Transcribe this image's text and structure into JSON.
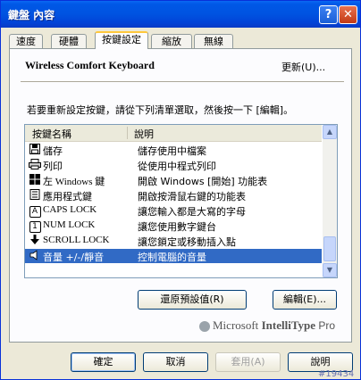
{
  "window": {
    "title": "鍵盤 內容",
    "help_glyph": "?",
    "close_glyph": "✕"
  },
  "tabs": [
    {
      "label": "速度"
    },
    {
      "label": "硬體"
    },
    {
      "label": "按鍵設定",
      "active": true
    },
    {
      "label": "縮放"
    },
    {
      "label": "無線"
    }
  ],
  "header": {
    "keyboard_name": "Wireless Comfort Keyboard",
    "update_link": "更新(U)..."
  },
  "instructions": "若要重新設定按鍵，請從下列清單選取，然後按一下 [編輯]。",
  "list": {
    "columns": [
      "按鍵名稱",
      "說明"
    ],
    "rows": [
      {
        "icon": "floppy-disk-icon",
        "key": "儲存",
        "desc": "儲存使用中檔案"
      },
      {
        "icon": "printer-icon",
        "key": "列印",
        "desc": "從使用中程式列印"
      },
      {
        "icon": "windows-flag-icon",
        "key": "左 Windows 鍵",
        "desc": "開啟 Windows [開始] 功能表"
      },
      {
        "icon": "context-menu-icon",
        "key": "應用程式鍵",
        "desc": "開啟按滑鼠右鍵的功能表"
      },
      {
        "icon": "capslock-icon",
        "icon_glyph": "A",
        "key": "CAPS LOCK",
        "desc": "讓您輸入都是大寫的字母"
      },
      {
        "icon": "numlock-icon",
        "icon_glyph": "1",
        "key": "NUM LOCK",
        "desc": "讓您使用數字鍵台"
      },
      {
        "icon": "scroll-arrow-icon",
        "key": "SCROLL LOCK",
        "desc": "讓您鎖定或移動插入點"
      },
      {
        "icon": "speaker-icon",
        "key": "音量 +/-/靜音",
        "desc": "控制電腦的音量",
        "selected": true
      }
    ]
  },
  "buttons": {
    "restore_defaults": "還原預設值(R)",
    "edit": "編輯(E)...",
    "ok": "確定",
    "cancel": "取消",
    "apply": "套用(A)",
    "help": "說明"
  },
  "branding": {
    "ms": "Microsoft",
    "product_bold": "IntelliType",
    "product_rest": "Pro"
  },
  "watermark": "#19434",
  "colors": {
    "selection": "#316ac5",
    "titlebar": "#0053e1",
    "tab_highlight": "#ffc83c"
  }
}
